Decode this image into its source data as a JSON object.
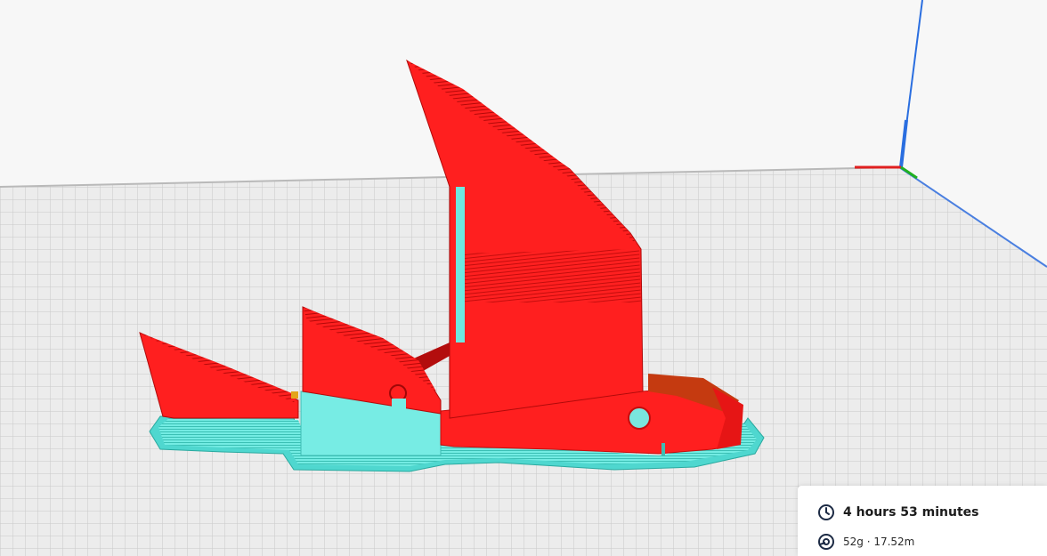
{
  "print_info": {
    "time_icon": "clock-icon",
    "material_icon": "spool-icon",
    "estimated_time": "4 hours 53 minutes",
    "material_usage": "52g · 17.52m"
  },
  "colors": {
    "background": "#f7f7f7",
    "build_plate": "#e9e9e9",
    "grid_line": "#c6c6c6",
    "model_wall": "#ff1f1f",
    "model_shadow": "#c40d0d",
    "support_skirt": "#6ee8e0",
    "axis_x": "#e02020",
    "axis_y": "#20b020",
    "axis_z": "#2a6ee0"
  }
}
